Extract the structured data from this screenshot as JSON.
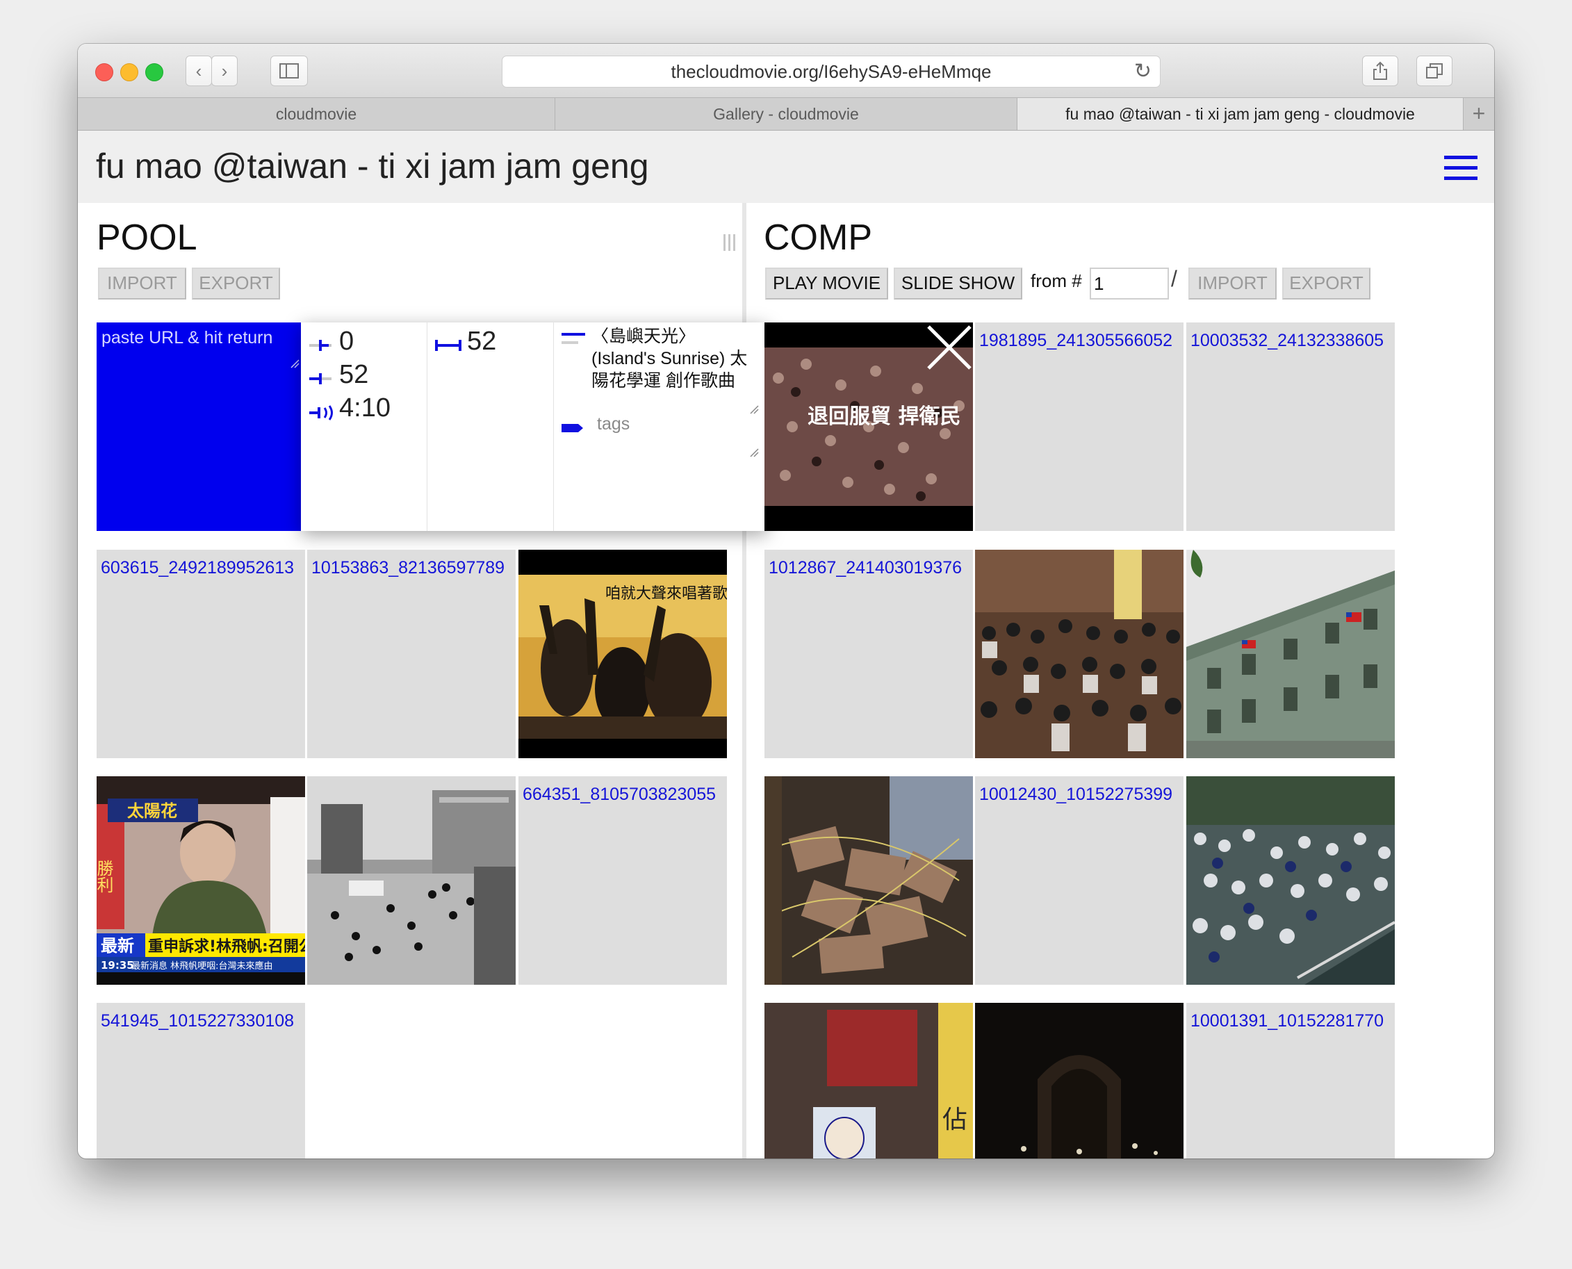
{
  "browser": {
    "url": "thecloudmovie.org/I6ehySA9-eHeMmqe",
    "tabs": [
      "cloudmovie",
      "Gallery - cloudmovie",
      "fu mao @taiwan - ti xi jam jam geng - cloudmovie"
    ],
    "new_tab": "+"
  },
  "page": {
    "title": "fu mao @taiwan - ti xi jam jam geng"
  },
  "pool": {
    "title": "POOL",
    "import_label": "IMPORT",
    "export_label": "EXPORT",
    "input_placeholder": "paste URL & hit return",
    "tiles": [
      "603615_2492189952613",
      "10153863_82136597789",
      "664351_8105703823055",
      "541945_1015227330108"
    ]
  },
  "comp": {
    "title": "COMP",
    "play_label": "PLAY MOVIE",
    "slide_label": "SLIDE SHOW",
    "from_label": "from #",
    "from_value": "1",
    "slash": "/",
    "import_label": "IMPORT",
    "export_label": "EXPORT",
    "tiles": [
      "1981895_241305566052",
      "10003532_24132338605",
      "1012867_241403019376",
      "10012430_10152275399",
      "10001391_10152281770"
    ]
  },
  "editor": {
    "start": "0",
    "end": "52",
    "duration": "4:10",
    "length": "52",
    "description": "〈島嶼天光〉 (Island's Sunrise) 太陽花學運 創作歌曲",
    "tags_placeholder": "tags",
    "image_caption": "退回服貿 捍衛民"
  },
  "tile_texts": {
    "poster_caption": "咱就大聲來唱著歌",
    "news_logo": "太陽花",
    "news_headline": "重申訴求!林飛帆:召開公民",
    "news_tag": "最新",
    "news_time": "19:35",
    "news_ticker": "最新消息  林飛帆哽咽:台灣未來應由",
    "news_side": "勝利",
    "banner": "佔"
  },
  "colors": {
    "accent": "#1010e0",
    "link": "#1515d8",
    "tile_bg": "#dedede"
  }
}
